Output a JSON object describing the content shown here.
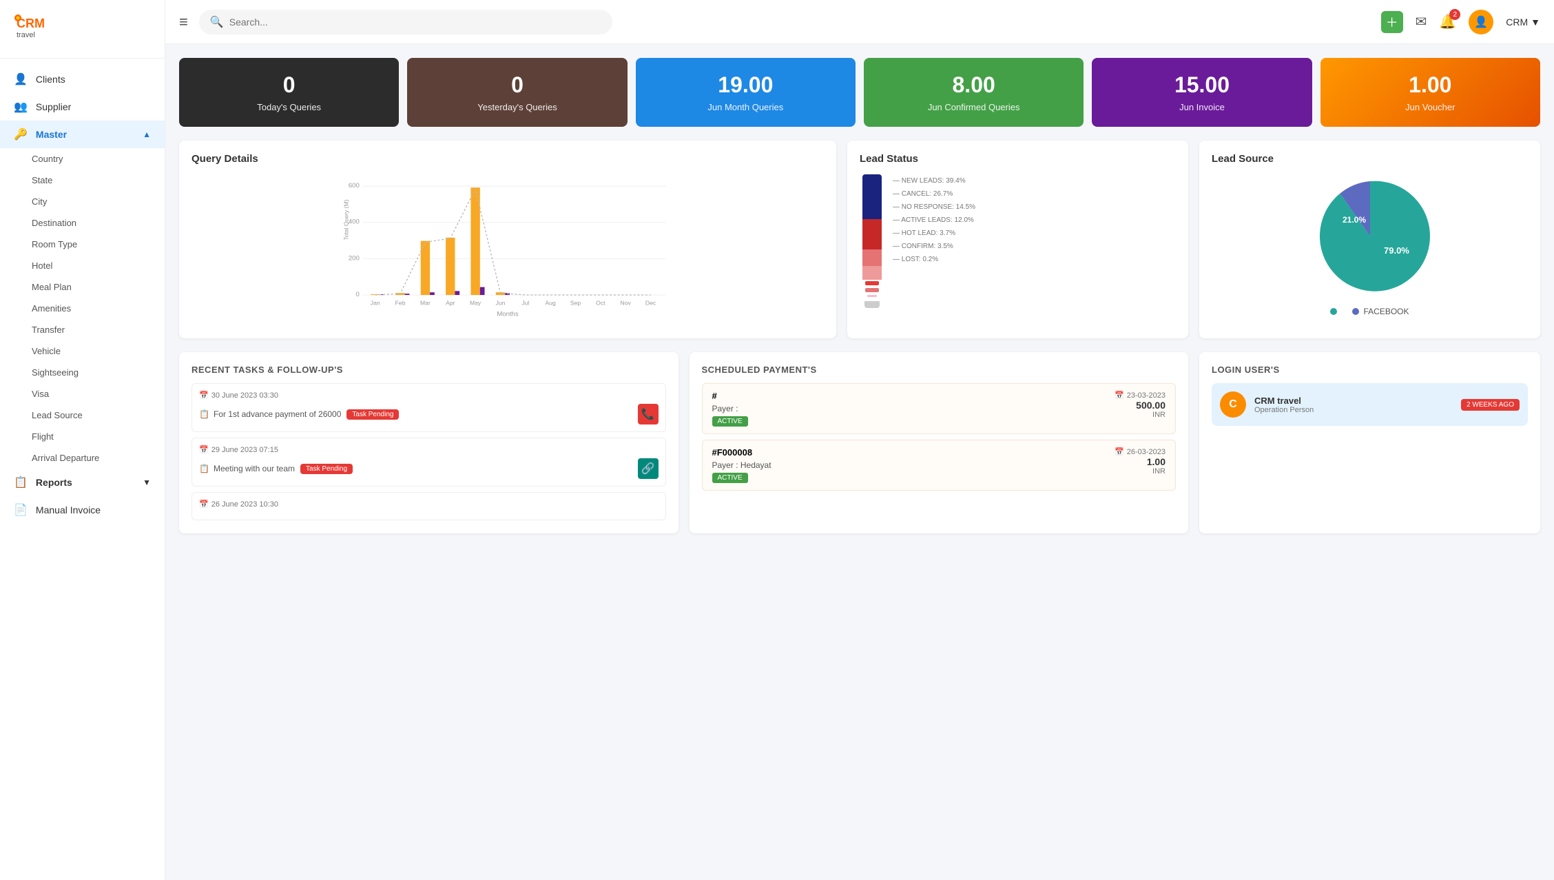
{
  "sidebar": {
    "logo_text": "CRM\ntravel",
    "nav_items": [
      {
        "id": "clients",
        "label": "Clients",
        "icon": "👤",
        "type": "link"
      },
      {
        "id": "supplier",
        "label": "Supplier",
        "icon": "👥",
        "type": "link"
      },
      {
        "id": "master",
        "label": "Master",
        "icon": "🔑",
        "type": "section",
        "expanded": true
      },
      {
        "id": "country",
        "label": "Country",
        "type": "sub"
      },
      {
        "id": "state",
        "label": "State",
        "type": "sub"
      },
      {
        "id": "city",
        "label": "City",
        "type": "sub"
      },
      {
        "id": "destination",
        "label": "Destination",
        "type": "sub"
      },
      {
        "id": "room-type",
        "label": "Room Type",
        "type": "sub"
      },
      {
        "id": "hotel",
        "label": "Hotel",
        "type": "sub"
      },
      {
        "id": "meal-plan",
        "label": "Meal Plan",
        "type": "sub"
      },
      {
        "id": "amenities",
        "label": "Amenities",
        "type": "sub"
      },
      {
        "id": "transfer",
        "label": "Transfer",
        "type": "sub"
      },
      {
        "id": "vehicle",
        "label": "Vehicle",
        "type": "sub"
      },
      {
        "id": "sightseeing",
        "label": "Sightseeing",
        "type": "sub"
      },
      {
        "id": "visa",
        "label": "Visa",
        "type": "sub"
      },
      {
        "id": "lead-source",
        "label": "Lead Source",
        "type": "sub"
      },
      {
        "id": "flight",
        "label": "Flight",
        "type": "sub"
      },
      {
        "id": "arrival-departure",
        "label": "Arrival Departure",
        "type": "sub"
      },
      {
        "id": "reports",
        "label": "Reports",
        "icon": "📋",
        "type": "section",
        "expanded": false
      },
      {
        "id": "manual-invoice",
        "label": "Manual Invoice",
        "icon": "📄",
        "type": "link"
      }
    ]
  },
  "header": {
    "hamburger_icon": "≡",
    "search_placeholder": "Search...",
    "plus_icon": "＋",
    "mail_icon": "✉",
    "bell_icon": "🔔",
    "notification_count": "2",
    "user_name": "CRM",
    "user_avatar": "👤",
    "dropdown_icon": "▼"
  },
  "stat_cards": [
    {
      "id": "today-queries",
      "value": "0",
      "label": "Today's Queries",
      "color_class": "card-black"
    },
    {
      "id": "yesterday-queries",
      "value": "0",
      "label": "Yesterday's Queries",
      "color_class": "card-brown"
    },
    {
      "id": "jun-month-queries",
      "value": "19.00",
      "label": "Jun Month Queries",
      "color_class": "card-blue"
    },
    {
      "id": "jun-confirmed-queries",
      "value": "8.00",
      "label": "Jun Confirmed Queries",
      "color_class": "card-green"
    },
    {
      "id": "jun-invoice",
      "value": "15.00",
      "label": "Jun Invoice",
      "color_class": "card-purple"
    },
    {
      "id": "jun-voucher",
      "value": "1.00",
      "label": "Jun Voucher",
      "color_class": "card-orange"
    }
  ],
  "query_chart": {
    "title": "Query Details",
    "y_label": "Total Query (M)",
    "x_label": "Months",
    "months": [
      "Jan",
      "Feb",
      "Mar",
      "Apr",
      "May",
      "Jun",
      "Jul",
      "Aug",
      "Sep",
      "Oct",
      "Nov",
      "Dec"
    ],
    "values": [
      2,
      4,
      230,
      250,
      540,
      10,
      0,
      0,
      0,
      0,
      0,
      0
    ],
    "values2": [
      1,
      2,
      10,
      15,
      30,
      8,
      0,
      0,
      0,
      0,
      0,
      0
    ]
  },
  "lead_status": {
    "title": "Lead Status",
    "items": [
      {
        "label": "NEW LEADS: 39.4%",
        "color": "#1a237e",
        "pct": 39.4
      },
      {
        "label": "CANCEL: 26.7%",
        "color": "#c62828",
        "pct": 26.7
      },
      {
        "label": "NO RESPONSE: 14.5%",
        "color": "#e57373",
        "pct": 14.5
      },
      {
        "label": "ACTIVE LEADS: 12.0%",
        "color": "#ef9a9a",
        "pct": 12.0
      },
      {
        "label": "HOT LEAD: 3.7%",
        "color": "#ffcdd2",
        "pct": 3.7
      },
      {
        "label": "CONFIRM: 3.5%",
        "color": "#ef9a9a",
        "pct": 3.5
      },
      {
        "label": "LOST: 0.2%",
        "color": "#f8bbd0",
        "pct": 0.2
      }
    ]
  },
  "lead_source": {
    "title": "Lead Source",
    "segments": [
      {
        "label": "79.0%",
        "color": "#26a69a",
        "pct": 79
      },
      {
        "label": "21.0%",
        "color": "#5c6bc0",
        "pct": 21
      }
    ],
    "legend": [
      {
        "color": "#26a69a",
        "label": ""
      },
      {
        "color": "#5c6bc0",
        "label": "FACEBOOK"
      }
    ]
  },
  "tasks": {
    "title": "RECENT TASKS & FOLLOW-UP'S",
    "items": [
      {
        "date": "30 June 2023 03:30",
        "desc": "For 1st advance payment of 26000",
        "badge": "Task Pending",
        "badge_color": "red",
        "action_icon": "📞",
        "action_color": "red"
      },
      {
        "date": "29 June 2023 07:15",
        "desc": "Meeting with our team",
        "badge": "Task Pending",
        "badge_color": "red",
        "action_icon": "🔗",
        "action_color": "teal"
      },
      {
        "date": "26 June 2023 10:30",
        "desc": "",
        "badge": "",
        "badge_color": "green",
        "action_icon": "",
        "action_color": "green"
      }
    ]
  },
  "payments": {
    "title": "SCHEDULED PAYMENT'S",
    "items": [
      {
        "id": "#",
        "date": "23-03-2023",
        "payer": "Payer :",
        "amount": "500.00",
        "currency": "INR",
        "status": "ACTIVE"
      },
      {
        "id": "#F000008",
        "date": "26-03-2023",
        "payer": "Payer : Hedayat",
        "amount": "1.00",
        "currency": "INR",
        "status": "ACTIVE"
      }
    ]
  },
  "login_users": {
    "title": "LOGIN USER'S",
    "items": [
      {
        "avatar_letter": "C",
        "name": "CRM travel",
        "role": "Operation Person",
        "time_badge": "2 WEEKS AGO"
      }
    ]
  }
}
